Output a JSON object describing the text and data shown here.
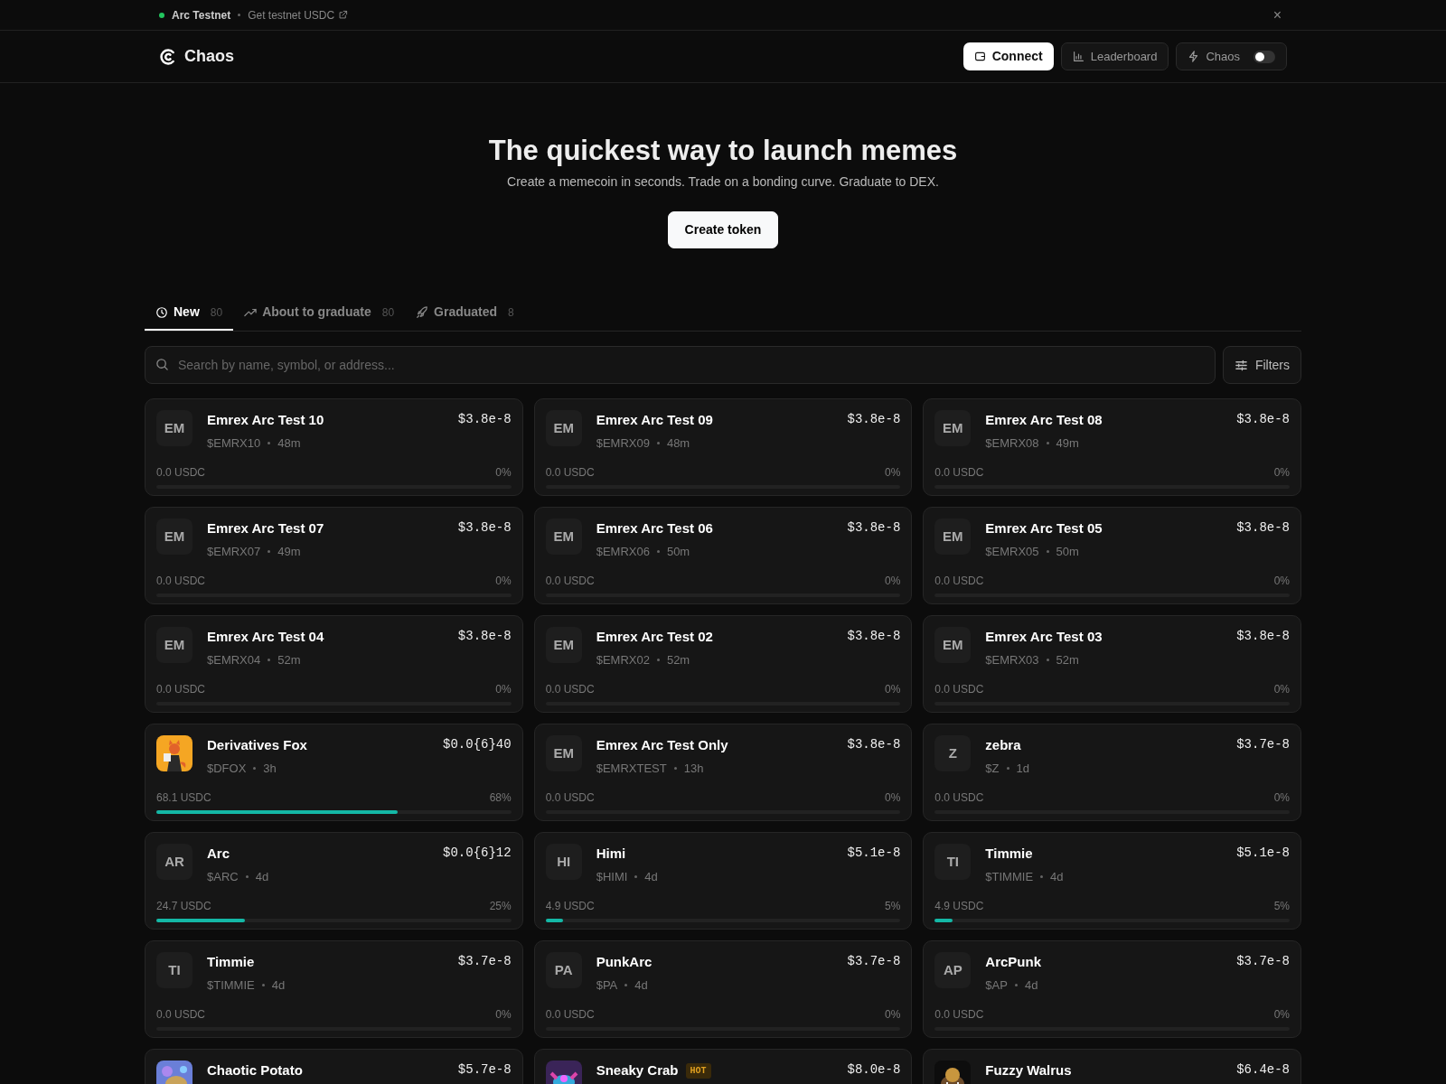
{
  "topbar": {
    "network": "Arc Testnet",
    "link": "Get testnet USDC",
    "close": "×"
  },
  "navbar": {
    "brand": "Chaos",
    "buttons": [
      {
        "label": "Connect",
        "kind": "primary"
      },
      {
        "label": "Leaderboard",
        "kind": "chart"
      },
      {
        "label": "Chaos",
        "kind": "toggle",
        "on": false
      }
    ]
  },
  "hero": {
    "title": "The quickest way to launch memes",
    "subtitle": "Create a memecoin in seconds. Trade on a bonding curve. Graduate to DEX.",
    "button": "Create token"
  },
  "tabs": [
    {
      "label": "New",
      "count": "80",
      "selected": true
    },
    {
      "label": "About to graduate",
      "count": "80",
      "selected": false
    },
    {
      "label": "Graduated",
      "count": "8",
      "selected": false
    }
  ],
  "search": {
    "placeholder": "Search by name, symbol, or address..."
  },
  "filters": "Filters",
  "tokens": [
    {
      "name": "Emrex Arc Test 10",
      "avatar": "EM",
      "ticker": "$EMRX10",
      "age": "48m",
      "price": "$3.8e-8",
      "raised": "0.0 USDC",
      "percent": "0%",
      "level": 0
    },
    {
      "name": "Emrex Arc Test 09",
      "avatar": "EM",
      "ticker": "$EMRX09",
      "age": "48m",
      "price": "$3.8e-8",
      "raised": "0.0 USDC",
      "percent": "0%",
      "level": 0
    },
    {
      "name": "Emrex Arc Test 08",
      "avatar": "EM",
      "ticker": "$EMRX08",
      "age": "49m",
      "price": "$3.8e-8",
      "raised": "0.0 USDC",
      "percent": "0%",
      "level": 0
    },
    {
      "name": "Emrex Arc Test 07",
      "avatar": "EM",
      "ticker": "$EMRX07",
      "age": "49m",
      "price": "$3.8e-8",
      "raised": "0.0 USDC",
      "percent": "0%",
      "level": 0
    },
    {
      "name": "Emrex Arc Test 06",
      "avatar": "EM",
      "ticker": "$EMRX06",
      "age": "50m",
      "price": "$3.8e-8",
      "raised": "0.0 USDC",
      "percent": "0%",
      "level": 0
    },
    {
      "name": "Emrex Arc Test 05",
      "avatar": "EM",
      "ticker": "$EMRX05",
      "age": "50m",
      "price": "$3.8e-8",
      "raised": "0.0 USDC",
      "percent": "0%",
      "level": 0
    },
    {
      "name": "Emrex Arc Test 04",
      "avatar": "EM",
      "ticker": "$EMRX04",
      "age": "52m",
      "price": "$3.8e-8",
      "raised": "0.0 USDC",
      "percent": "0%",
      "level": 0
    },
    {
      "name": "Emrex Arc Test 02",
      "avatar": "EM",
      "ticker": "$EMRX02",
      "age": "52m",
      "price": "$3.8e-8",
      "raised": "0.0 USDC",
      "percent": "0%",
      "level": 0
    },
    {
      "name": "Emrex Arc Test 03",
      "avatar": "EM",
      "ticker": "$EMRX03",
      "age": "52m",
      "price": "$3.8e-8",
      "raised": "0.0 USDC",
      "percent": "0%",
      "level": 0
    },
    {
      "name": "Derivatives Fox",
      "kind": "picture",
      "ticker": "$DFOX",
      "age": "3h",
      "price": "$0.0{6}40",
      "raised": "68.1 USDC",
      "percent": "68%",
      "level": 0.68
    },
    {
      "name": "Emrex Arc Test Only",
      "avatar": "EM",
      "ticker": "$EMRXTEST",
      "age": "13h",
      "price": "$3.8e-8",
      "raised": "0.0 USDC",
      "percent": "0%",
      "level": 0
    },
    {
      "name": "zebra",
      "avatar": "Z",
      "ticker": "$Z",
      "age": "1d",
      "price": "$3.7e-8",
      "raised": "0.0 USDC",
      "percent": "0%",
      "level": 0
    },
    {
      "name": "Arc",
      "avatar": "AR",
      "ticker": "$ARC",
      "age": "4d",
      "price": "$0.0{6}12",
      "raised": "24.7 USDC",
      "percent": "25%",
      "level": 0.25
    },
    {
      "name": "Himi",
      "avatar": "HI",
      "ticker": "$HIMI",
      "age": "4d",
      "price": "$5.1e-8",
      "raised": "4.9 USDC",
      "percent": "5%",
      "level": 0.05
    },
    {
      "name": "Timmie",
      "avatar": "TI",
      "ticker": "$TIMMIE",
      "age": "4d",
      "price": "$5.1e-8",
      "raised": "4.9 USDC",
      "percent": "5%",
      "level": 0.05
    },
    {
      "name": "Timmie",
      "avatar": "TI",
      "ticker": "$TIMMIE",
      "age": "4d",
      "price": "$3.7e-8",
      "raised": "0.0 USDC",
      "percent": "0%",
      "level": 0
    },
    {
      "name": "PunkArc",
      "avatar": "PA",
      "ticker": "$PA",
      "age": "4d",
      "price": "$3.7e-8",
      "raised": "0.0 USDC",
      "percent": "0%",
      "level": 0
    },
    {
      "name": "ArcPunk",
      "avatar": "AP",
      "ticker": "$AP",
      "age": "4d",
      "price": "$3.7e-8",
      "raised": "0.0 USDC",
      "percent": "0%",
      "level": 0
    },
    {
      "name": "Chaotic Potato",
      "kind": "picture",
      "price": "$5.7e-8"
    },
    {
      "name": "Sneaky Crab",
      "kind": "picture",
      "badge": "HOT",
      "price": "$8.0e-8"
    },
    {
      "name": "Fuzzy Walrus",
      "kind": "picture",
      "price": "$6.4e-8"
    }
  ]
}
